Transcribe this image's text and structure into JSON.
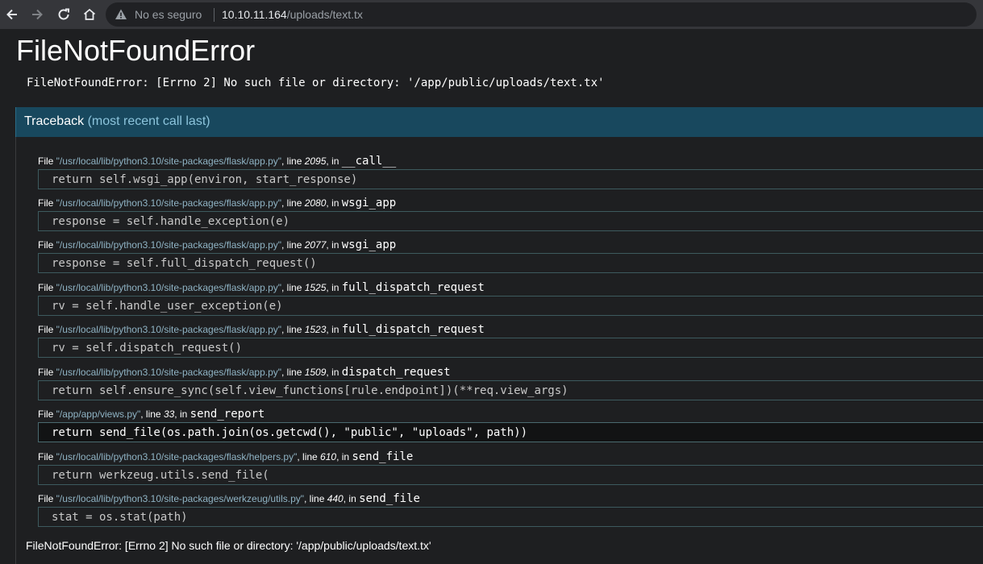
{
  "browser": {
    "security_label": "No es seguro",
    "url_host": "10.10.11.164",
    "url_path": "/uploads/text.tx"
  },
  "error": {
    "title": "FileNotFoundError",
    "message": "FileNotFoundError: [Errno 2] No such file or directory: '/app/public/uploads/text.tx'"
  },
  "traceback": {
    "label": "Traceback",
    "sublabel": "(most recent call last)",
    "frames": [
      {
        "file": "\"/usr/local/lib/python3.10/site-packages/flask/app.py\"",
        "line": "2095",
        "func": "__call__",
        "code": "return self.wsgi_app(environ, start_response)"
      },
      {
        "file": "\"/usr/local/lib/python3.10/site-packages/flask/app.py\"",
        "line": "2080",
        "func": "wsgi_app",
        "code": "response = self.handle_exception(e)"
      },
      {
        "file": "\"/usr/local/lib/python3.10/site-packages/flask/app.py\"",
        "line": "2077",
        "func": "wsgi_app",
        "code": "response = self.full_dispatch_request()"
      },
      {
        "file": "\"/usr/local/lib/python3.10/site-packages/flask/app.py\"",
        "line": "1525",
        "func": "full_dispatch_request",
        "code": "rv = self.handle_user_exception(e)"
      },
      {
        "file": "\"/usr/local/lib/python3.10/site-packages/flask/app.py\"",
        "line": "1523",
        "func": "full_dispatch_request",
        "code": "rv = self.dispatch_request()"
      },
      {
        "file": "\"/usr/local/lib/python3.10/site-packages/flask/app.py\"",
        "line": "1509",
        "func": "dispatch_request",
        "code": "return self.ensure_sync(self.view_functions[rule.endpoint])(**req.view_args)"
      },
      {
        "file": "\"/app/app/views.py\"",
        "line": "33",
        "func": "send_report",
        "code": "return send_file(os.path.join(os.getcwd(), \"public\", \"uploads\", path))"
      },
      {
        "file": "\"/usr/local/lib/python3.10/site-packages/flask/helpers.py\"",
        "line": "610",
        "func": "send_file",
        "code": "return werkzeug.utils.send_file("
      },
      {
        "file": "\"/usr/local/lib/python3.10/site-packages/werkzeug/utils.py\"",
        "line": "440",
        "func": "send_file",
        "code": "stat = os.stat(path)"
      }
    ],
    "footer": "FileNotFoundError: [Errno 2] No such file or directory: '/app/public/uploads/text.tx'"
  },
  "text_static": {
    "file_word": "File ",
    "line_word": ", line ",
    "in_word": ", in "
  }
}
